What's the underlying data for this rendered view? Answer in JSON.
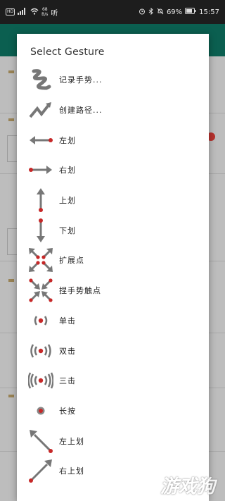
{
  "status_bar": {
    "hd_badge": "HD",
    "network_speed_value": "68",
    "network_speed_unit": "B/s",
    "extra": "听",
    "battery": "69%",
    "time": "15:57"
  },
  "dialog": {
    "title": "Select Gesture",
    "items": [
      {
        "label": "记录手势...",
        "icon": "squiggle-icon"
      },
      {
        "label": "创建路径...",
        "icon": "zigzag-path-icon"
      },
      {
        "label": "左划",
        "icon": "swipe-left-icon"
      },
      {
        "label": "右划",
        "icon": "swipe-right-icon"
      },
      {
        "label": "上划",
        "icon": "swipe-up-icon"
      },
      {
        "label": "下划",
        "icon": "swipe-down-icon"
      },
      {
        "label": "扩展点",
        "icon": "expand-points-icon"
      },
      {
        "label": "捏手势触点",
        "icon": "pinch-points-icon"
      },
      {
        "label": "单击",
        "icon": "single-tap-icon"
      },
      {
        "label": "双击",
        "icon": "double-tap-icon"
      },
      {
        "label": "三击",
        "icon": "triple-tap-icon"
      },
      {
        "label": "长按",
        "icon": "long-press-icon"
      },
      {
        "label": "左上划",
        "icon": "swipe-up-left-icon"
      },
      {
        "label": "右上划",
        "icon": "swipe-up-right-icon"
      }
    ]
  },
  "watermark": "游戏狗",
  "colors": {
    "icon_gray": "#777777",
    "dot_red": "#c62828",
    "app_bar": "#0b5f50"
  }
}
